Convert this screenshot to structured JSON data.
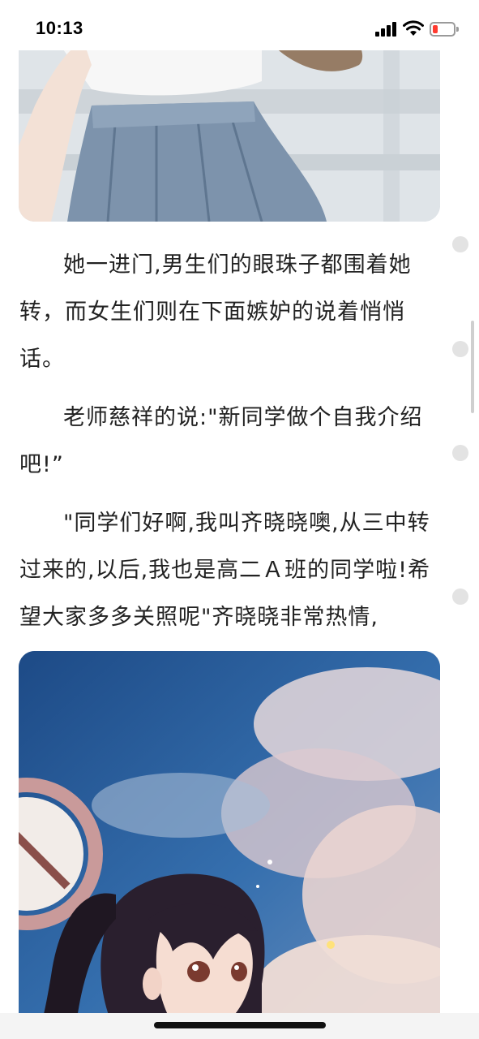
{
  "status_bar": {
    "time": "10:13",
    "battery_color": "#ff3b30"
  },
  "article": {
    "paragraphs": [
      "她一进门,男生们的眼珠子都围着她转，而女生们则在下面嫉妒的说着悄悄话。",
      "老师慈祥的说:\"新同学做个自我介绍吧!”",
      "\"同学们好啊,我叫齐晓晓噢,从三中转过来的,以后,我也是高二Ａ班的同学啦!希望大家多多关照呢\"齐晓晓非常热情,"
    ]
  },
  "images": {
    "top": "illustration-schoolgirl-skirt",
    "bottom": "illustration-girl-ponytail-sky"
  }
}
